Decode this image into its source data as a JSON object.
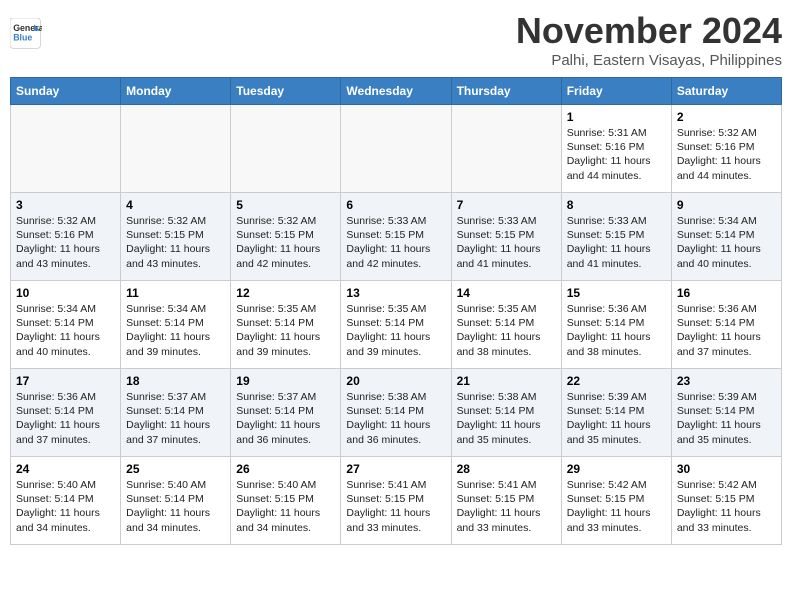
{
  "header": {
    "logo_line1": "General",
    "logo_line2": "Blue",
    "month": "November 2024",
    "location": "Palhi, Eastern Visayas, Philippines"
  },
  "weekdays": [
    "Sunday",
    "Monday",
    "Tuesday",
    "Wednesday",
    "Thursday",
    "Friday",
    "Saturday"
  ],
  "weeks": [
    [
      {
        "day": "",
        "info": ""
      },
      {
        "day": "",
        "info": ""
      },
      {
        "day": "",
        "info": ""
      },
      {
        "day": "",
        "info": ""
      },
      {
        "day": "",
        "info": ""
      },
      {
        "day": "1",
        "info": "Sunrise: 5:31 AM\nSunset: 5:16 PM\nDaylight: 11 hours\nand 44 minutes."
      },
      {
        "day": "2",
        "info": "Sunrise: 5:32 AM\nSunset: 5:16 PM\nDaylight: 11 hours\nand 44 minutes."
      }
    ],
    [
      {
        "day": "3",
        "info": "Sunrise: 5:32 AM\nSunset: 5:16 PM\nDaylight: 11 hours\nand 43 minutes."
      },
      {
        "day": "4",
        "info": "Sunrise: 5:32 AM\nSunset: 5:15 PM\nDaylight: 11 hours\nand 43 minutes."
      },
      {
        "day": "5",
        "info": "Sunrise: 5:32 AM\nSunset: 5:15 PM\nDaylight: 11 hours\nand 42 minutes."
      },
      {
        "day": "6",
        "info": "Sunrise: 5:33 AM\nSunset: 5:15 PM\nDaylight: 11 hours\nand 42 minutes."
      },
      {
        "day": "7",
        "info": "Sunrise: 5:33 AM\nSunset: 5:15 PM\nDaylight: 11 hours\nand 41 minutes."
      },
      {
        "day": "8",
        "info": "Sunrise: 5:33 AM\nSunset: 5:15 PM\nDaylight: 11 hours\nand 41 minutes."
      },
      {
        "day": "9",
        "info": "Sunrise: 5:34 AM\nSunset: 5:14 PM\nDaylight: 11 hours\nand 40 minutes."
      }
    ],
    [
      {
        "day": "10",
        "info": "Sunrise: 5:34 AM\nSunset: 5:14 PM\nDaylight: 11 hours\nand 40 minutes."
      },
      {
        "day": "11",
        "info": "Sunrise: 5:34 AM\nSunset: 5:14 PM\nDaylight: 11 hours\nand 39 minutes."
      },
      {
        "day": "12",
        "info": "Sunrise: 5:35 AM\nSunset: 5:14 PM\nDaylight: 11 hours\nand 39 minutes."
      },
      {
        "day": "13",
        "info": "Sunrise: 5:35 AM\nSunset: 5:14 PM\nDaylight: 11 hours\nand 39 minutes."
      },
      {
        "day": "14",
        "info": "Sunrise: 5:35 AM\nSunset: 5:14 PM\nDaylight: 11 hours\nand 38 minutes."
      },
      {
        "day": "15",
        "info": "Sunrise: 5:36 AM\nSunset: 5:14 PM\nDaylight: 11 hours\nand 38 minutes."
      },
      {
        "day": "16",
        "info": "Sunrise: 5:36 AM\nSunset: 5:14 PM\nDaylight: 11 hours\nand 37 minutes."
      }
    ],
    [
      {
        "day": "17",
        "info": "Sunrise: 5:36 AM\nSunset: 5:14 PM\nDaylight: 11 hours\nand 37 minutes."
      },
      {
        "day": "18",
        "info": "Sunrise: 5:37 AM\nSunset: 5:14 PM\nDaylight: 11 hours\nand 37 minutes."
      },
      {
        "day": "19",
        "info": "Sunrise: 5:37 AM\nSunset: 5:14 PM\nDaylight: 11 hours\nand 36 minutes."
      },
      {
        "day": "20",
        "info": "Sunrise: 5:38 AM\nSunset: 5:14 PM\nDaylight: 11 hours\nand 36 minutes."
      },
      {
        "day": "21",
        "info": "Sunrise: 5:38 AM\nSunset: 5:14 PM\nDaylight: 11 hours\nand 35 minutes."
      },
      {
        "day": "22",
        "info": "Sunrise: 5:39 AM\nSunset: 5:14 PM\nDaylight: 11 hours\nand 35 minutes."
      },
      {
        "day": "23",
        "info": "Sunrise: 5:39 AM\nSunset: 5:14 PM\nDaylight: 11 hours\nand 35 minutes."
      }
    ],
    [
      {
        "day": "24",
        "info": "Sunrise: 5:40 AM\nSunset: 5:14 PM\nDaylight: 11 hours\nand 34 minutes."
      },
      {
        "day": "25",
        "info": "Sunrise: 5:40 AM\nSunset: 5:14 PM\nDaylight: 11 hours\nand 34 minutes."
      },
      {
        "day": "26",
        "info": "Sunrise: 5:40 AM\nSunset: 5:15 PM\nDaylight: 11 hours\nand 34 minutes."
      },
      {
        "day": "27",
        "info": "Sunrise: 5:41 AM\nSunset: 5:15 PM\nDaylight: 11 hours\nand 33 minutes."
      },
      {
        "day": "28",
        "info": "Sunrise: 5:41 AM\nSunset: 5:15 PM\nDaylight: 11 hours\nand 33 minutes."
      },
      {
        "day": "29",
        "info": "Sunrise: 5:42 AM\nSunset: 5:15 PM\nDaylight: 11 hours\nand 33 minutes."
      },
      {
        "day": "30",
        "info": "Sunrise: 5:42 AM\nSunset: 5:15 PM\nDaylight: 11 hours\nand 33 minutes."
      }
    ]
  ]
}
